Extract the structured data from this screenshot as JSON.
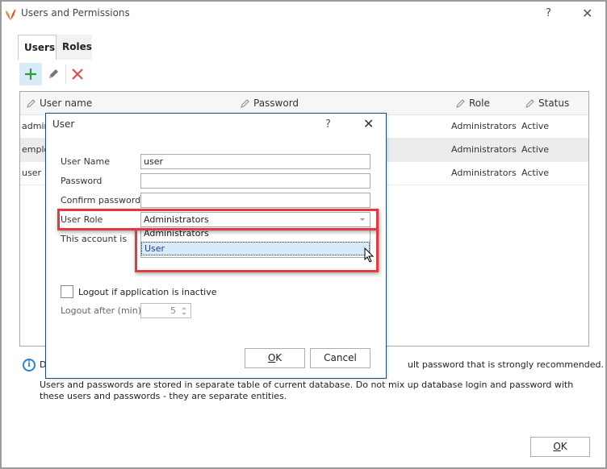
{
  "window": {
    "title": "Users and Permissions",
    "help_label": "?",
    "close_label": "✕"
  },
  "tabs": [
    {
      "label": "Users",
      "active": true
    },
    {
      "label": "Roles",
      "active": false
    }
  ],
  "toolbar": {
    "add_icon": "plus-icon",
    "edit_icon": "pencil-icon",
    "delete_icon": "x-icon"
  },
  "grid": {
    "columns": [
      {
        "label": "User name",
        "icon": "pencil-icon"
      },
      {
        "label": "Password",
        "icon": "pencil-icon"
      },
      {
        "label": "Role",
        "icon": "pencil-icon"
      },
      {
        "label": "Status",
        "icon": "pencil-icon"
      }
    ],
    "rows": [
      {
        "user": "admin",
        "role": "Administrators",
        "status": "Active"
      },
      {
        "user": "employ",
        "role": "Administrators",
        "status": "Active"
      },
      {
        "user": "user",
        "role": "Administrators",
        "status": "Active"
      }
    ]
  },
  "info": {
    "icon": "info-icon",
    "line1_start": "De",
    "line1_end": "ult password that is strongly recommended.",
    "line2": "Users and passwords are stored in separate table of current database. Do not mix up database login and password with these users and passwords - they are separate entities."
  },
  "main_ok": {
    "label_u": "O",
    "label_rest": "K"
  },
  "dialog": {
    "title": "User",
    "help_label": "?",
    "close_label": "✕",
    "labels": {
      "user_name": "User Name",
      "password": "Password",
      "confirm_password": "Confirm password",
      "user_role": "User Role",
      "account_is": "This account is"
    },
    "values": {
      "user_name": "user",
      "password": "",
      "confirm_password": ""
    },
    "user_role": {
      "selected": "Administrators",
      "options": [
        "Administrators",
        "User"
      ],
      "hovered": "User"
    },
    "logout_inactive": {
      "label": "Logout if application is inactive",
      "checked": false
    },
    "logout_after": {
      "label": "Logout after (min)",
      "value": "5"
    },
    "ok": {
      "label_u": "O",
      "label_rest": "K"
    },
    "cancel_label": "Cancel"
  },
  "colors": {
    "highlight": "#e5393f",
    "selection": "#d9ebf9",
    "accent_add": "#2e9e3a",
    "accent_delete": "#e0494b"
  }
}
